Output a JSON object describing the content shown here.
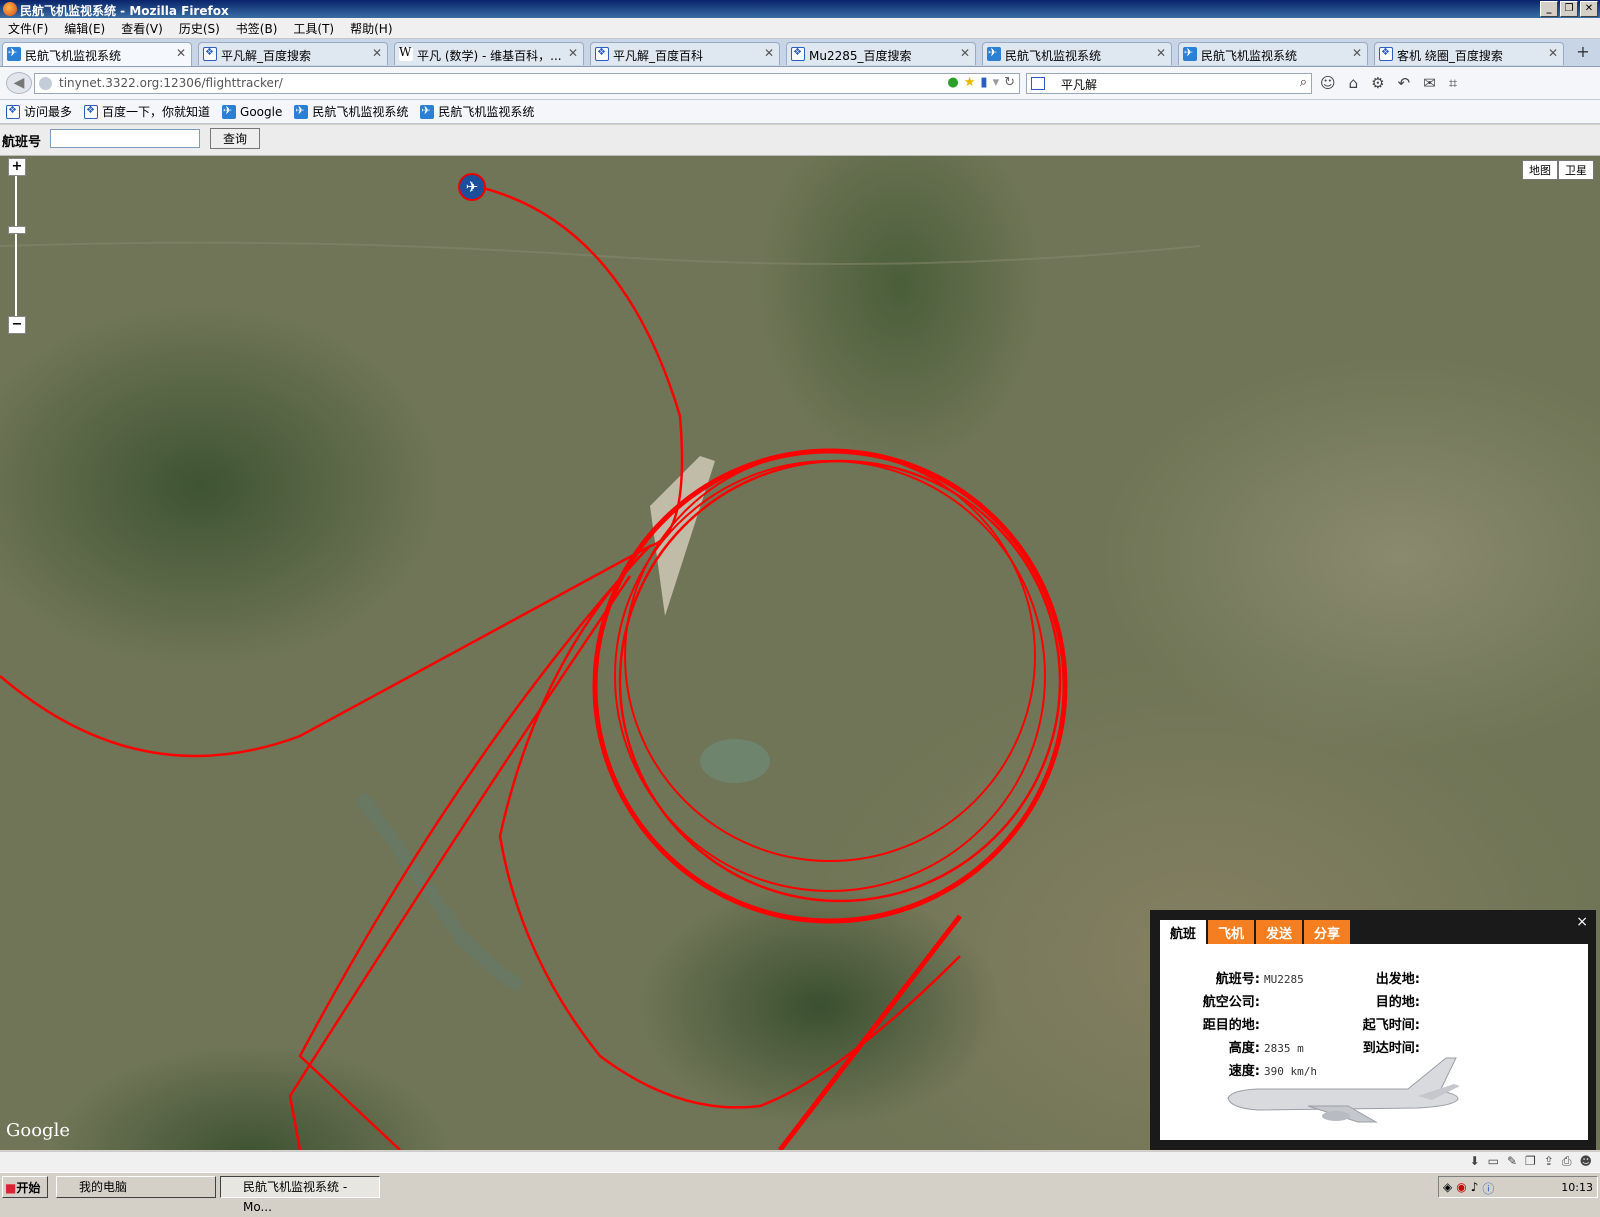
{
  "window": {
    "title": "民航飞机监视系统 - Mozilla Firefox"
  },
  "menu": [
    "文件(F)",
    "编辑(E)",
    "查看(V)",
    "历史(S)",
    "书签(B)",
    "工具(T)",
    "帮助(H)"
  ],
  "tabs": [
    {
      "label": "民航飞机监视系统",
      "icon": "plane-icon",
      "active": true
    },
    {
      "label": "平凡解_百度搜索",
      "icon": "baidu-icon"
    },
    {
      "label": "平凡 (数学) - 维基百科，...",
      "icon": "wikipedia-icon"
    },
    {
      "label": "平凡解_百度百科",
      "icon": "baidu-icon"
    },
    {
      "label": "Mu2285_百度搜索",
      "icon": "baidu-icon"
    },
    {
      "label": "民航飞机监视系统",
      "icon": "plane-icon"
    },
    {
      "label": "民航飞机监视系统",
      "icon": "plane-icon"
    },
    {
      "label": "客机 绕圈_百度搜索",
      "icon": "baidu-icon"
    }
  ],
  "navbar": {
    "url": "tinynet.3322.org:12306/flighttracker/",
    "search": "平凡解"
  },
  "bookmarks": [
    {
      "label": "访问最多"
    },
    {
      "label": "百度一下，你就知道"
    },
    {
      "label": "Google"
    },
    {
      "label": "民航飞机监视系统"
    },
    {
      "label": "民航飞机监视系统"
    }
  ],
  "query": {
    "label": "航班号",
    "button": "查询",
    "value": ""
  },
  "map": {
    "type_buttons": [
      "地图",
      "卫星"
    ],
    "logo": "Google",
    "route_color": "#ff0000"
  },
  "info": {
    "tabs": [
      "航班",
      "飞机",
      "发送",
      "分享"
    ],
    "labels": {
      "flight": "航班号:",
      "airline": "航空公司:",
      "distance": "距目的地:",
      "altitude": "高度:",
      "speed": "速度:",
      "from": "出发地:",
      "to": "目的地:",
      "depart": "起飞时间:",
      "arrive": "到达时间:"
    },
    "values": {
      "flight": "MU2285",
      "airline": "",
      "distance": "",
      "altitude": "2835 m",
      "speed": "390 km/h",
      "from": "",
      "to": "",
      "depart": "",
      "arrive": ""
    }
  },
  "taskbar": {
    "start": "开始",
    "items": [
      "我的电脑",
      "民航飞机监视系统 - Mo..."
    ],
    "clock": "10:13"
  }
}
